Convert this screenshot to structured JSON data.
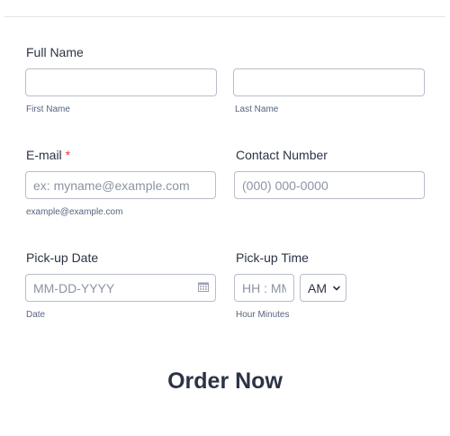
{
  "full_name": {
    "label": "Full Name",
    "first": {
      "value": "",
      "sublabel": "First Name"
    },
    "last": {
      "value": "",
      "sublabel": "Last Name"
    }
  },
  "email": {
    "label": "E-mail",
    "required_mark": "*",
    "placeholder": "ex: myname@example.com",
    "sublabel": "example@example.com"
  },
  "contact": {
    "label": "Contact Number",
    "placeholder": "(000) 000-0000"
  },
  "pickup_date": {
    "label": "Pick-up Date",
    "placeholder": "MM-DD-YYYY",
    "sublabel": "Date"
  },
  "pickup_time": {
    "label": "Pick-up Time",
    "placeholder": "HH : MM",
    "ampm": "AM",
    "sublabel": "Hour Minutes"
  },
  "submit": {
    "label": "Order Now"
  },
  "icons": {
    "date": "calendar-icon",
    "dropdown": "chevron-down-icon"
  }
}
